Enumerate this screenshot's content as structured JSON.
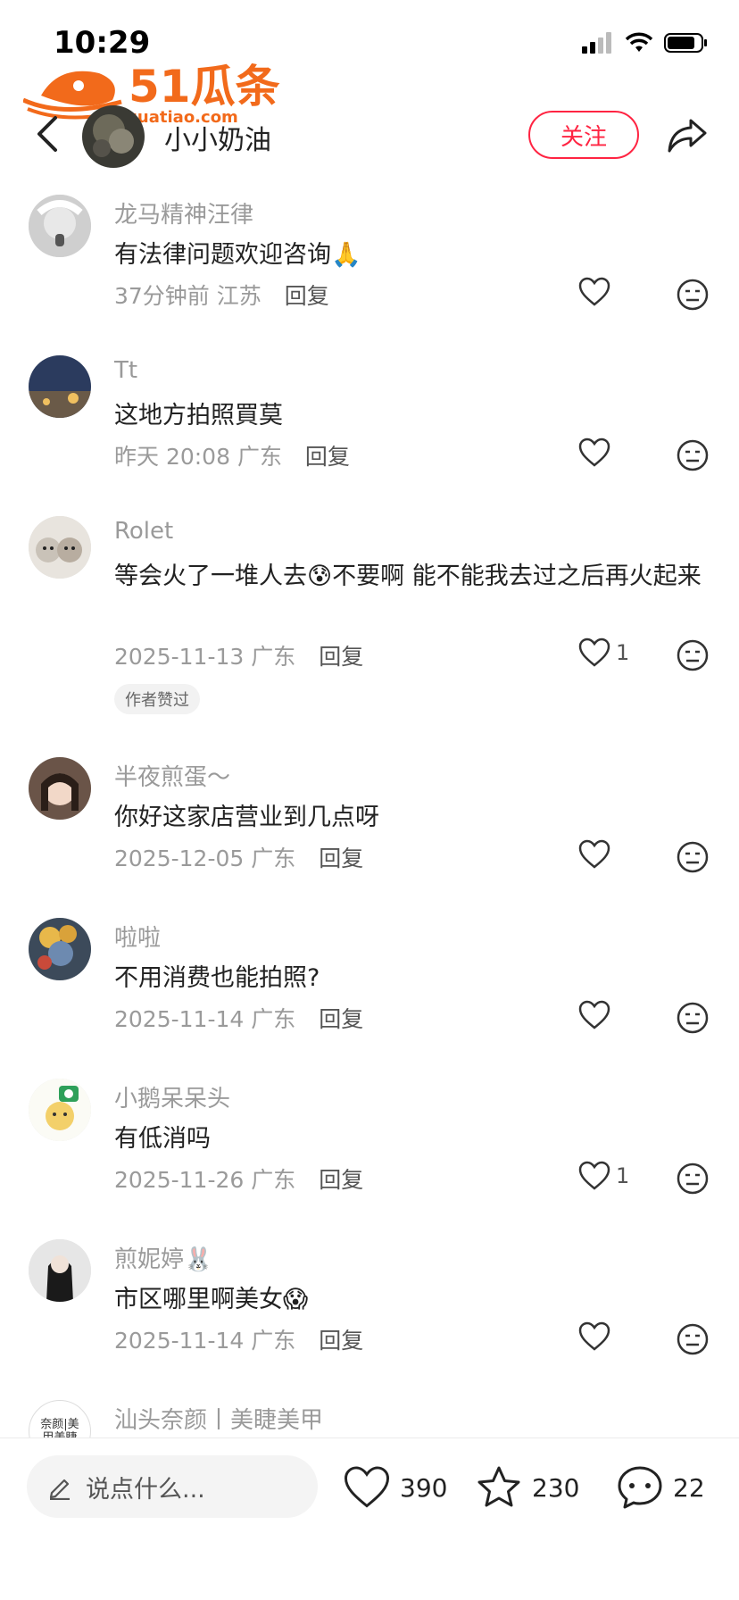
{
  "status_bar": {
    "time": "10:29"
  },
  "watermark": {
    "brand": "51瓜条",
    "url": "51guatiao.com"
  },
  "header": {
    "author_name": "小小奶油",
    "follow_label": "关注"
  },
  "comments": [
    {
      "username": "龙马精神汪律",
      "text": "有法律问题欢迎咨询🙏",
      "time": "37分钟前",
      "location": "江苏",
      "reply": "回复",
      "likes": ""
    },
    {
      "username": "Tt",
      "text": "这地方拍照買莫",
      "time": "昨天 20:08",
      "location": "广东",
      "reply": "回复",
      "likes": ""
    },
    {
      "username": "Rolet",
      "text": "等会火了一堆人去😰不要啊 能不能我去过之后再火起来",
      "time": "2025-11-13",
      "location": "广东",
      "reply": "回复",
      "likes": "1",
      "badge": "作者赞过"
    },
    {
      "username": "半夜煎蛋～",
      "text": "你好这家店营业到几点呀",
      "time": "2025-12-05",
      "location": "广东",
      "reply": "回复",
      "likes": ""
    },
    {
      "username": "啦啦",
      "text": "不用消费也能拍照?",
      "time": "2025-11-14",
      "location": "广东",
      "reply": "回复",
      "likes": ""
    },
    {
      "username": "小鹅呆呆头",
      "text": "有低消吗",
      "time": "2025-11-26",
      "location": "广东",
      "reply": "回复",
      "likes": "1"
    },
    {
      "username": "煎妮婷🐰",
      "text": "市区哪里啊美女😱",
      "time": "2025-11-14",
      "location": "广东",
      "reply": "回复",
      "likes": ""
    },
    {
      "username": "汕头奈颜丨美睫美甲",
      "avatar_text": "奈颜|美甲美睫"
    }
  ],
  "bottom_bar": {
    "placeholder": "说点什么...",
    "likes": "390",
    "favorites": "230",
    "comments": "22"
  },
  "colors": {
    "accent": "#ff2442",
    "muted": "#9a9a9a"
  }
}
